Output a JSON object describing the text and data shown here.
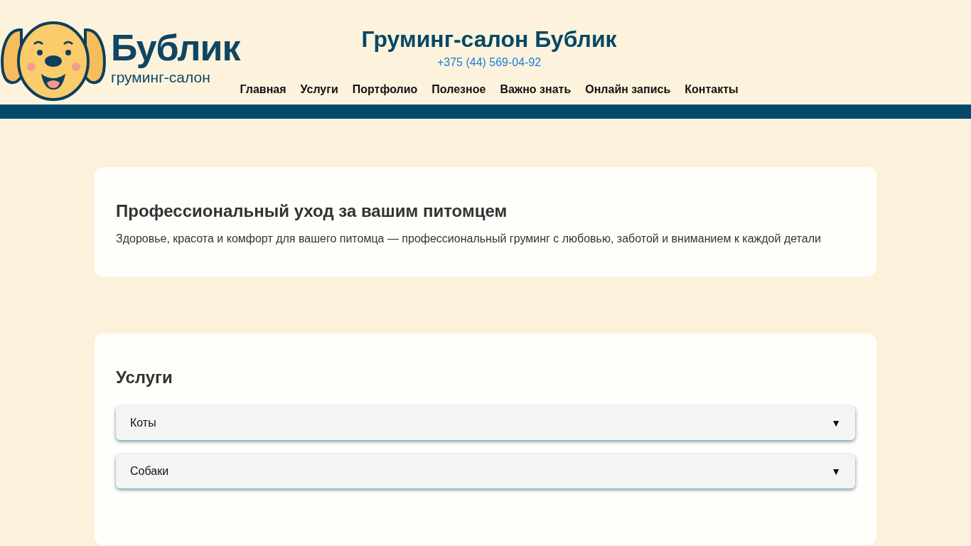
{
  "header": {
    "logo": {
      "name": "Бублик",
      "tagline": "груминг-салон"
    },
    "title": "Груминг-салон Бублик",
    "phone": "+375 (44) 569-04-92",
    "nav": [
      {
        "label": "Главная"
      },
      {
        "label": "Услуги"
      },
      {
        "label": "Портфолио"
      },
      {
        "label": "Полезное"
      },
      {
        "label": "Важно знать"
      },
      {
        "label": "Онлайн запись"
      },
      {
        "label": "Контакты"
      }
    ]
  },
  "intro": {
    "heading": "Профессиональный уход за вашим питомцем",
    "text": "Здоровье, красота и комфорт для вашего питомца — профессиональный груминг с любовью, заботой и вниманием к каждой детали"
  },
  "services": {
    "heading": "Услуги",
    "items": [
      {
        "label": "Коты",
        "toggle": "▼",
        "expanded": false
      },
      {
        "label": "Собаки",
        "toggle": "▼",
        "expanded": false
      }
    ]
  }
}
